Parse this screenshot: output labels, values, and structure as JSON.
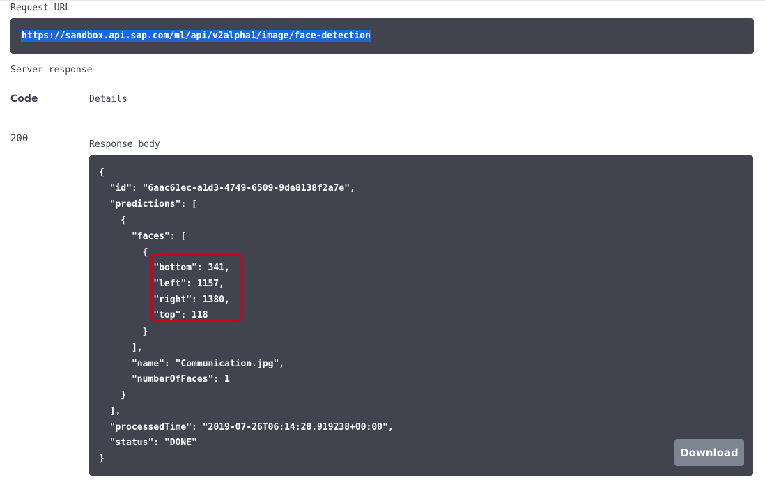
{
  "request_url": {
    "label": "Request URL",
    "value": "https://sandbox.api.sap.com/ml/api/v2alpha1/image/face-detection"
  },
  "server_response": {
    "label": "Server response",
    "code_header": "Code",
    "details_header": "Details",
    "status_code": "200",
    "response_body_label": "Response body",
    "body_lines": [
      "{",
      "  \"id\": \"6aac61ec-a1d3-4749-6509-9de8138f2a7e\",",
      "  \"predictions\": [",
      "    {",
      "      \"faces\": [",
      "        {",
      "          \"bottom\": 341,",
      "          \"left\": 1157,",
      "          \"right\": 1380,",
      "          \"top\": 118",
      "        }",
      "      ],",
      "      \"name\": \"Communication.jpg\",",
      "      \"numberOfFaces\": 1",
      "    }",
      "  ],",
      "  \"processedTime\": \"2019-07-26T06:14:28.919238+00:00\",",
      "  \"status\": \"DONE\"",
      "}"
    ],
    "download_label": "Download"
  },
  "colors": {
    "code_bg": "#41444e",
    "url_selection": "#1e67d6",
    "highlight_border": "#d0021b",
    "download_bg": "#7d8492"
  }
}
